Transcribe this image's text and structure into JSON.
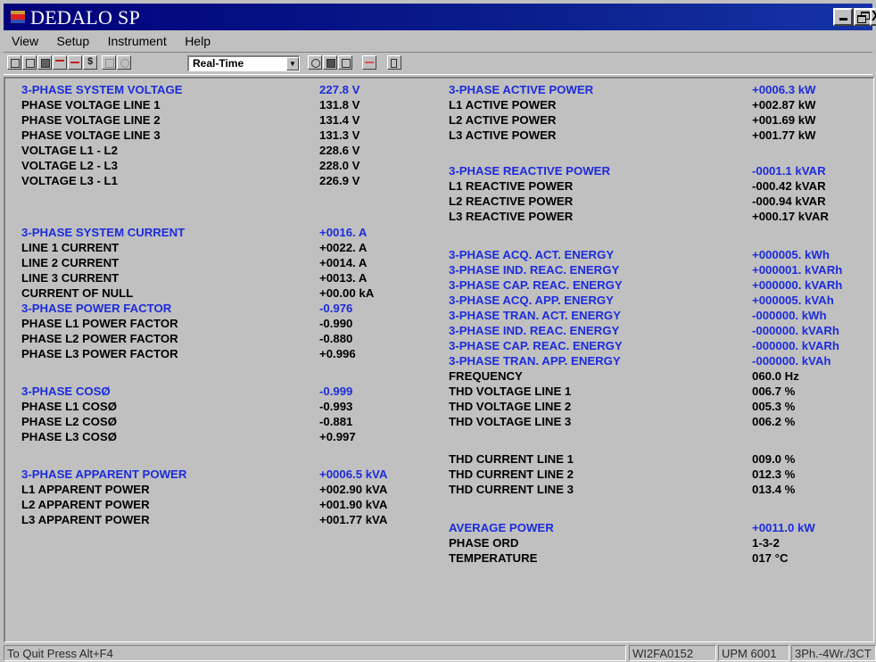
{
  "window": {
    "title": "DEDALO SP",
    "controls": {
      "minimize": "_",
      "close": "X"
    }
  },
  "menu": [
    "View",
    "Setup",
    "Instrument",
    "Help"
  ],
  "toolbar": {
    "mode_select_value": "Real-Time",
    "dollar_label": "$",
    "icons": [
      "new-icon",
      "open-icon",
      "save-icon",
      "chart-icon",
      "bar-icon",
      "cost-icon",
      "print-icon",
      "zoom-icon",
      "record-icon",
      "stop-icon",
      "pause-icon",
      "delete-icon",
      "exit-icon"
    ]
  },
  "left_rows": [
    {
      "label": "3-PHASE SYSTEM VOLTAGE",
      "value": "227.8  V",
      "highlight": true
    },
    {
      "label": "PHASE VOLTAGE LINE 1",
      "value": "131.8  V",
      "highlight": false
    },
    {
      "label": "PHASE VOLTAGE LINE 2",
      "value": "131.4  V",
      "highlight": false
    },
    {
      "label": "PHASE VOLTAGE LINE 3",
      "value": "131.3  V",
      "highlight": false
    },
    {
      "label": "VOLTAGE L1 - L2",
      "value": "228.6  V",
      "highlight": false
    },
    {
      "label": "VOLTAGE L2 - L3",
      "value": "228.0  V",
      "highlight": false
    },
    {
      "label": "VOLTAGE L3 - L1",
      "value": "226.9  V",
      "highlight": false
    },
    {
      "label": "3-PHASE SYSTEM CURRENT",
      "value": "+0016.  A",
      "highlight": true
    },
    {
      "label": "LINE 1 CURRENT",
      "value": "+0022.  A",
      "highlight": false
    },
    {
      "label": "LINE 2 CURRENT",
      "value": "+0014.  A",
      "highlight": false
    },
    {
      "label": "LINE 3 CURRENT",
      "value": "+0013.  A",
      "highlight": false
    },
    {
      "label": "CURRENT OF NULL",
      "value": "+00.00 kA",
      "highlight": false
    },
    {
      "label": "3-PHASE POWER FACTOR",
      "value": "-0.976",
      "highlight": true
    },
    {
      "label": "PHASE L1 POWER FACTOR",
      "value": "-0.990",
      "highlight": false
    },
    {
      "label": "PHASE L2 POWER FACTOR",
      "value": "-0.880",
      "highlight": false
    },
    {
      "label": "PHASE L3 POWER FACTOR",
      "value": "+0.996",
      "highlight": false
    },
    {
      "label": "3-PHASE  COSØ",
      "value": "-0.999",
      "highlight": true
    },
    {
      "label": "PHASE L1  COSØ",
      "value": "-0.993",
      "highlight": false
    },
    {
      "label": "PHASE L2  COSØ",
      "value": "-0.881",
      "highlight": false
    },
    {
      "label": "PHASE L3  COSØ",
      "value": "+0.997",
      "highlight": false
    },
    {
      "label": "3-PHASE APPARENT POWER",
      "value": "+0006.5 kVA",
      "highlight": true
    },
    {
      "label": "L1 APPARENT POWER",
      "value": "+002.90 kVA",
      "highlight": false
    },
    {
      "label": "L2 APPARENT POWER",
      "value": "+001.90 kVA",
      "highlight": false
    },
    {
      "label": "L3 APPARENT POWER",
      "value": "+001.77 kVA",
      "highlight": false
    }
  ],
  "right_rows": [
    {
      "label": "3-PHASE ACTIVE POWER",
      "value": "+0006.3 kW",
      "highlight": true
    },
    {
      "label": "L1 ACTIVE POWER",
      "value": "+002.87 kW",
      "highlight": false
    },
    {
      "label": "L2 ACTIVE POWER",
      "value": "+001.69 kW",
      "highlight": false
    },
    {
      "label": "L3 ACTIVE POWER",
      "value": "+001.77 kW",
      "highlight": false
    },
    {
      "label": "3-PHASE REACTIVE POWER",
      "value": "-0001.1 kVAR",
      "highlight": true
    },
    {
      "label": "L1 REACTIVE POWER",
      "value": "-000.42 kVAR",
      "highlight": false
    },
    {
      "label": "L2 REACTIVE POWER",
      "value": "-000.94 kVAR",
      "highlight": false
    },
    {
      "label": "L3 REACTIVE POWER",
      "value": "+000.17 kVAR",
      "highlight": false
    },
    {
      "label": "3-PHASE ACQ. ACT. ENERGY",
      "value": "+000005. kWh",
      "highlight": true
    },
    {
      "label": "3-PHASE IND. REAC. ENERGY",
      "value": "+000001. kVARh",
      "highlight": true
    },
    {
      "label": "3-PHASE CAP. REAC. ENERGY",
      "value": "+000000. kVARh",
      "highlight": true
    },
    {
      "label": "3-PHASE ACQ.  APP. ENERGY",
      "value": "+000005. kVAh",
      "highlight": true
    },
    {
      "label": "3-PHASE TRAN. ACT. ENERGY",
      "value": "-000000. kWh",
      "highlight": true
    },
    {
      "label": "3-PHASE IND. REAC. ENERGY",
      "value": "-000000. kVARh",
      "highlight": true
    },
    {
      "label": "3-PHASE CAP. REAC. ENERGY",
      "value": "-000000. kVARh",
      "highlight": true
    },
    {
      "label": "3-PHASE TRAN. APP. ENERGY",
      "value": "-000000. kVAh",
      "highlight": true
    },
    {
      "label": "FREQUENCY",
      "value": "060.0  Hz",
      "highlight": false
    },
    {
      "label": "THD VOLTAGE LINE 1",
      "value": "006.7  %",
      "highlight": false
    },
    {
      "label": "THD VOLTAGE LINE 2",
      "value": "005.3  %",
      "highlight": false
    },
    {
      "label": "THD VOLTAGE LINE 3",
      "value": "006.2  %",
      "highlight": false
    },
    {
      "label": "THD CURRENT LINE 1",
      "value": "009.0  %",
      "highlight": false
    },
    {
      "label": "THD CURRENT LINE 2",
      "value": "012.3  %",
      "highlight": false
    },
    {
      "label": "THD CURRENT LINE 3",
      "value": "013.4  %",
      "highlight": false
    },
    {
      "label": "AVERAGE POWER",
      "value": "+0011.0 kW",
      "highlight": true
    },
    {
      "label": "PHASE ORD",
      "value": "1-3-2",
      "highlight": false
    },
    {
      "label": "TEMPERATURE",
      "value": "017  °C",
      "highlight": false
    }
  ],
  "status": {
    "message": "To Quit Press Alt+F4",
    "serial": "WI2FA0152",
    "model": "UPM 6001",
    "mode": "3Ph.-4Wr./3CT"
  },
  "colors": {
    "highlight": "#1c2cdc",
    "title_bar": "#00007b",
    "background": "#c0c0c0"
  }
}
